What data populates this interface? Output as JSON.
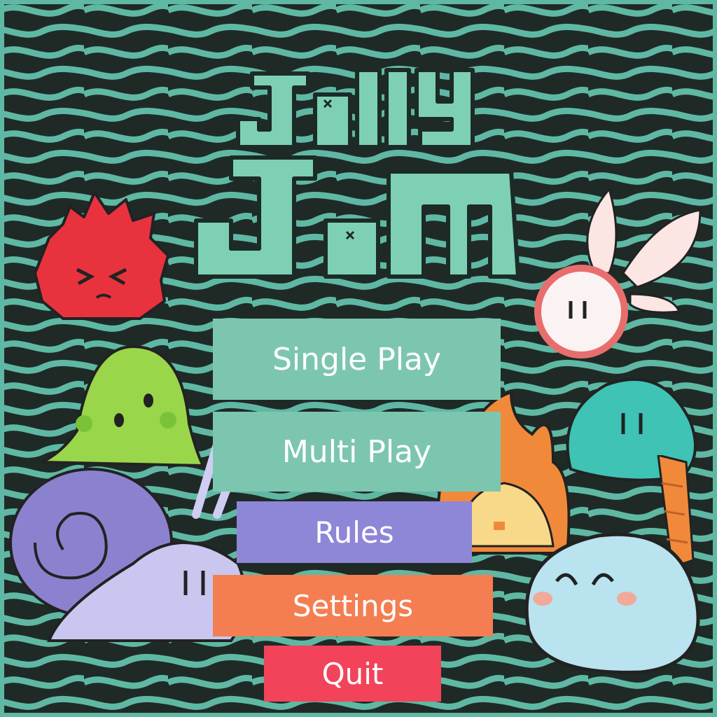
{
  "game": {
    "title_line1": "Jelly",
    "title_line2": "Jam"
  },
  "menu": {
    "single_play": "Single Play",
    "multi_play": "Multi Play",
    "rules": "Rules",
    "settings": "Settings",
    "quit": "Quit"
  },
  "colors": {
    "background": "#1f2a27",
    "wave_line": "#5fb8a4",
    "logo_fill": "#7ed0b4",
    "button_teal": "#7cc6b0",
    "button_purple": "#8e86d6",
    "button_orange": "#f47e52",
    "button_red": "#f2435a"
  },
  "characters": [
    "red-spiky-jelly",
    "white-winged-jelly",
    "green-slime-jelly",
    "teal-jelly",
    "purple-snail-jelly",
    "light-blue-happy-jelly",
    "orange-flame-jelly"
  ]
}
